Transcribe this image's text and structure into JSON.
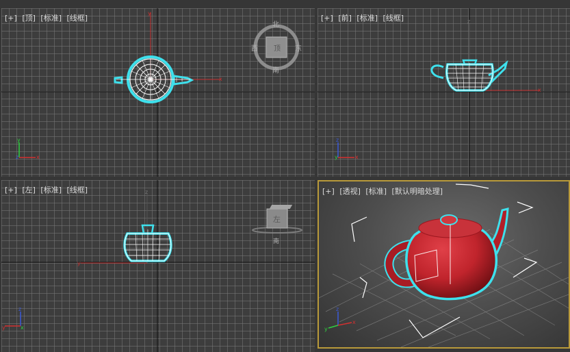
{
  "viewports": {
    "top": {
      "plus": "[+]",
      "view": "[顶]",
      "standard": "[标准]",
      "shading": "[线框]"
    },
    "front": {
      "plus": "[+]",
      "view": "[前]",
      "standard": "[标准]",
      "shading": "[线框]"
    },
    "left": {
      "plus": "[+]",
      "view": "[左]",
      "standard": "[标准]",
      "shading": "[线框]"
    },
    "persp": {
      "plus": "[+]",
      "view": "[透视]",
      "standard": "[标准]",
      "shading": "[默认明暗处理]"
    }
  },
  "viewcube": {
    "north": "北",
    "west": "西",
    "east": "东",
    "south": "南",
    "left_face": "左"
  },
  "axes": {
    "x": "x",
    "y": "y",
    "z": "z"
  },
  "colors": {
    "viewport_bg": "#3d3d3d",
    "grid_line": "#787878",
    "selection_outline": "#3ee0ec",
    "teapot_red": "#c0242c",
    "active_border": "#b99a3a",
    "axis_x": "#d43030",
    "axis_y": "#2fd040",
    "axis_z": "#3a5ad8"
  },
  "icons": [
    "viewcube-top",
    "viewcube-left",
    "axis-tripod-icon",
    "teapot-object"
  ]
}
